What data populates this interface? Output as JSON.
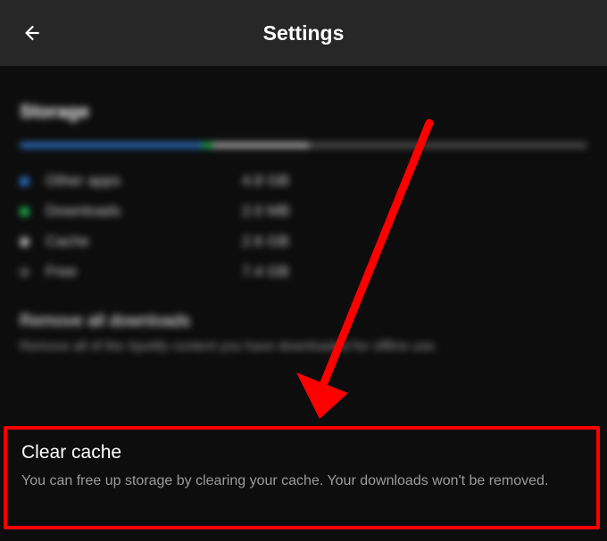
{
  "header": {
    "title": "Settings"
  },
  "storage": {
    "section_title": "Storage",
    "bar": {
      "blue_pct": 32,
      "green_pct": 2,
      "light_pct": 17,
      "dark_pct": 49
    },
    "legend": [
      {
        "dot": "blue",
        "label": "Other apps",
        "value": "4.8 GB"
      },
      {
        "dot": "green",
        "label": "Downloads",
        "value": "2.0 MB"
      },
      {
        "dot": "light",
        "label": "Cache",
        "value": "2.6 GB"
      },
      {
        "dot": "dark",
        "label": "Free",
        "value": "7.4 GB"
      }
    ]
  },
  "remove_downloads": {
    "title": "Remove all downloads",
    "desc": "Remove all of the Spotify content you have downloaded for offline use."
  },
  "clear_cache": {
    "title": "Clear cache",
    "desc": "You can free up storage by clearing your cache. Your downloads won't be removed."
  }
}
